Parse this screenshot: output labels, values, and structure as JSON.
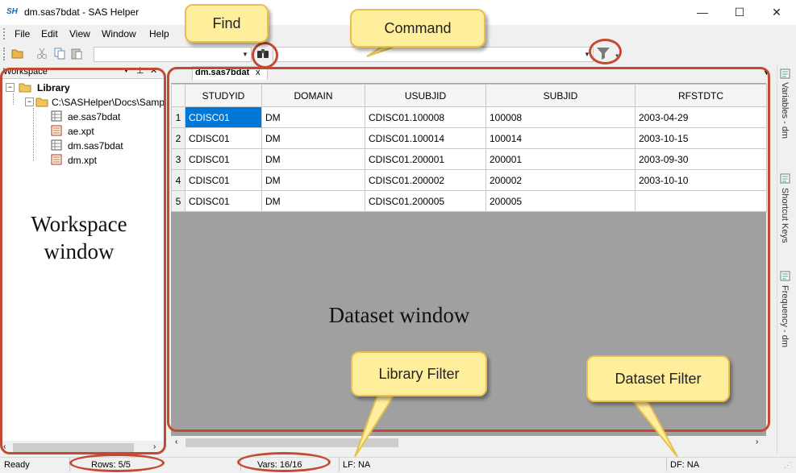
{
  "window": {
    "title": "dm.sas7bdat - SAS Helper",
    "logo": "SH",
    "minimize": "—",
    "maximize": "☐",
    "close": "✕"
  },
  "menu": [
    "File",
    "Edit",
    "View",
    "Window",
    "Help"
  ],
  "workspace": {
    "title": "Workspace",
    "tree": [
      {
        "label": "Library",
        "depth": 0,
        "icon": "folder-icon",
        "bold": true
      },
      {
        "label": "C:\\SASHelper\\Docs\\Samp",
        "depth": 1,
        "icon": "folder-icon"
      },
      {
        "label": "ae.sas7bdat",
        "depth": 2,
        "icon": "dataset-icon"
      },
      {
        "label": "ae.xpt",
        "depth": 2,
        "icon": "xpt-icon"
      },
      {
        "label": "dm.sas7bdat",
        "depth": 2,
        "icon": "dataset-icon"
      },
      {
        "label": "dm.xpt",
        "depth": 2,
        "icon": "xpt-icon"
      }
    ]
  },
  "dataset_tab": {
    "label": "dm.sas7bdat",
    "close": "x"
  },
  "grid": {
    "columns": [
      "STUDYID",
      "DOMAIN",
      "USUBJID",
      "SUBJID",
      "RFSTDTC"
    ],
    "rows": [
      [
        "1",
        "CDISC01",
        "DM",
        "CDISC01.100008",
        "100008",
        "2003-04-29"
      ],
      [
        "2",
        "CDISC01",
        "DM",
        "CDISC01.100014",
        "100014",
        "2003-10-15"
      ],
      [
        "3",
        "CDISC01",
        "DM",
        "CDISC01.200001",
        "200001",
        "2003-09-30"
      ],
      [
        "4",
        "CDISC01",
        "DM",
        "CDISC01.200002",
        "200002",
        "2003-10-10"
      ],
      [
        "5",
        "CDISC01",
        "DM",
        "CDISC01.200005",
        "200005",
        ""
      ]
    ]
  },
  "right_tabs": [
    "Variables - dm",
    "Shortcut Keys",
    "Frequency - dm"
  ],
  "status": {
    "ready": "Ready",
    "rows": "Rows: 5/5",
    "vars": "Vars: 16/16",
    "lf": "LF: NA",
    "df": "DF: NA"
  },
  "annotations": {
    "find": "Find",
    "command": "Command",
    "library_filter": "Library Filter",
    "dataset_filter": "Dataset Filter",
    "workspace_window": "Workspace window",
    "dataset_window": "Dataset window"
  },
  "colors": {
    "selection": "#0078d7",
    "callout_fill": "#ffef9c",
    "highlight_ring": "#c24a31"
  }
}
